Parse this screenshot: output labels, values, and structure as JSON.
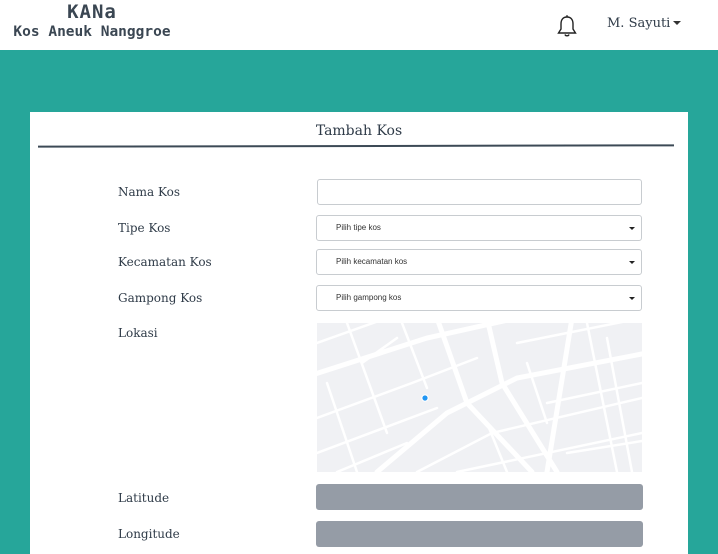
{
  "brand": {
    "title": "KANa",
    "subtitle": "Kos Aneuk Nanggroe"
  },
  "header": {
    "user_name": "M. Sayuti"
  },
  "icons": {
    "notifications": "bell-icon",
    "user_menu": "caret-down-icon",
    "select": "caret-down-icon"
  },
  "colors": {
    "page_background": "#26a69a",
    "navbar": "#ffffff",
    "card": "#ffffff",
    "text": "#2f3b48",
    "readonly_field": "#959ca6",
    "map_marker": "#2196f3"
  },
  "form": {
    "title": "Tambah Kos",
    "fields": {
      "nama_kos": {
        "label": "Nama Kos",
        "value": ""
      },
      "tipe_kos": {
        "label": "Tipe Kos",
        "selected": "Pilih tipe kos"
      },
      "kecamatan_kos": {
        "label": "Kecamatan Kos",
        "selected": "Pilih kecamatan kos"
      },
      "gampong_kos": {
        "label": "Gampong Kos",
        "selected": "Pilih gampong kos"
      },
      "lokasi": {
        "label": "Lokasi"
      },
      "latitude": {
        "label": "Latitude",
        "value": ""
      },
      "longitude": {
        "label": "Longitude",
        "value": ""
      }
    }
  }
}
